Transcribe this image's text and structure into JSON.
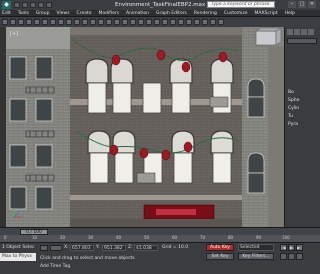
{
  "window": {
    "title": "Environment_TaskFinalEBP2.max",
    "search_placeholder": "Type a keyword or phrase",
    "minimize": "–",
    "maximize": "□",
    "close": "✕"
  },
  "menus": [
    "Edit",
    "Tools",
    "Group",
    "Views",
    "Create",
    "Modifiers",
    "Animation",
    "Graph Editors",
    "Rendering",
    "Customize",
    "MAXScript",
    "Help"
  ],
  "command_panel": {
    "rollout_labels": [
      "Bo",
      "Sphe",
      "Cylin",
      "Tu",
      "Pyra"
    ]
  },
  "timeline": {
    "slider": "0 / 100",
    "ticks": [
      "0",
      "10",
      "20",
      "30",
      "40",
      "50",
      "60",
      "70",
      "80",
      "90",
      "100"
    ]
  },
  "status": {
    "listener": "Max to Physx",
    "selection": "1 Object Selec",
    "msg1": "Click and drag to select and move objects",
    "msg2": "Add Time Tag",
    "x_value": "657.803",
    "y_value": "951.382",
    "z_value": "41.038",
    "grid": "Grid = 10.0",
    "autokey": "Auto Key",
    "selected": "Selected",
    "setkey": "Set Key",
    "key_filters": "Key Filters..."
  },
  "colors": {
    "accent_red": "#b72a2a",
    "menu_active": "#ff6a6a"
  }
}
